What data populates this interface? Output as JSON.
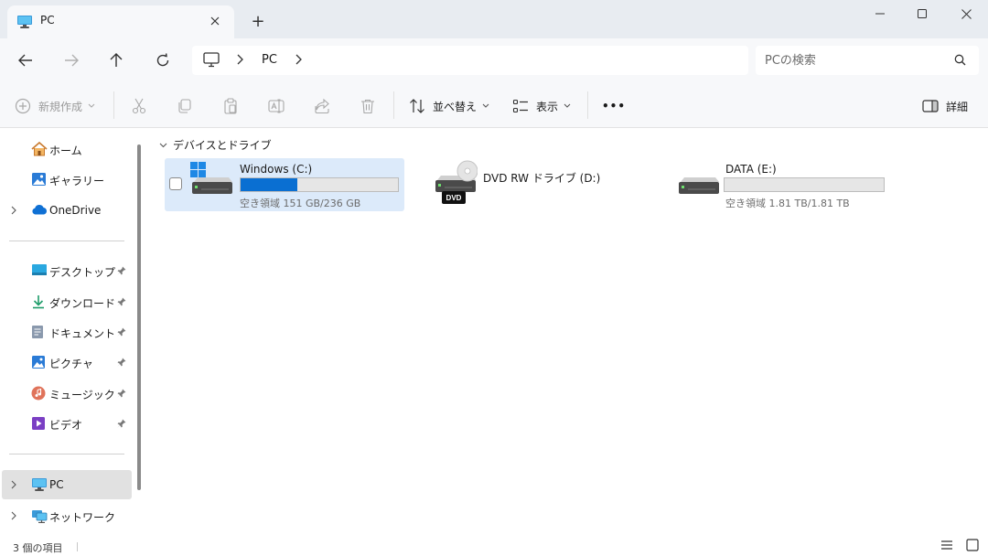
{
  "window": {
    "tab_title": "PC",
    "tab_icon": "monitor-icon",
    "new_tab_label": "+"
  },
  "navigation": {
    "breadcrumb": [
      "PC"
    ],
    "search_placeholder": "PCの検索"
  },
  "command_bar": {
    "new_label": "新規作成",
    "sort_label": "並べ替え",
    "view_label": "表示",
    "more_label": "•••",
    "details_label": "詳細"
  },
  "sidebar": {
    "quick": [
      {
        "label": "ホーム",
        "icon": "home-icon"
      },
      {
        "label": "ギャラリー",
        "icon": "gallery-icon"
      },
      {
        "label": "OneDrive",
        "icon": "cloud-icon"
      }
    ],
    "pinned": [
      {
        "label": "デスクトップ",
        "icon": "desktop-icon"
      },
      {
        "label": "ダウンロード",
        "icon": "download-icon"
      },
      {
        "label": "ドキュメント",
        "icon": "document-icon"
      },
      {
        "label": "ピクチャ",
        "icon": "picture-icon"
      },
      {
        "label": "ミュージック",
        "icon": "music-icon"
      },
      {
        "label": "ビデオ",
        "icon": "video-icon"
      }
    ],
    "locations": [
      {
        "label": "PC",
        "icon": "monitor-icon",
        "selected": true
      },
      {
        "label": "ネットワーク",
        "icon": "network-icon"
      }
    ]
  },
  "main": {
    "group_title": "デバイスとドライブ",
    "drives": [
      {
        "name": "Windows (C:)",
        "free_text": "空き領域 151 GB/236 GB",
        "used_fraction": 0.36,
        "icon": "windows-drive-icon",
        "selected": true
      },
      {
        "name": "DVD RW ドライブ (D:)",
        "icon": "dvd-drive-icon",
        "badge": "DVD"
      },
      {
        "name": "DATA (E:)",
        "free_text": "空き領域 1.81 TB/1.81 TB",
        "used_fraction": 0.0,
        "icon": "hard-drive-icon"
      }
    ]
  },
  "status": {
    "item_count": "3 個の項目"
  },
  "colors": {
    "accent": "#0a6fd2",
    "selection": "#dceafa",
    "chrome": "#f7f8fa"
  }
}
